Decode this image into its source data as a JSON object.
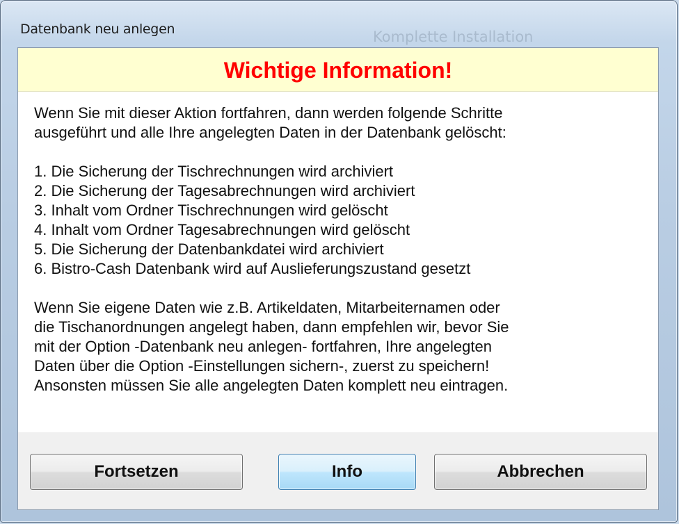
{
  "window": {
    "title": "Datenbank neu anlegen",
    "background_ghost_label": "Komplette Installation"
  },
  "banner": {
    "heading": "Wichtige Information!"
  },
  "body": {
    "intro_line1": "Wenn Sie mit dieser Aktion fortfahren, dann werden folgende Schritte",
    "intro_line2": "ausgeführt und alle Ihre angelegten Daten in der Datenbank gelöscht:",
    "steps": [
      "1. Die Sicherung der Tischrechnungen wird archiviert",
      "2. Die Sicherung der Tagesabrechnungen wird archiviert",
      "3. Inhalt vom Ordner Tischrechnungen wird gelöscht",
      "4. Inhalt vom Ordner Tagesabrechnungen wird gelöscht",
      "5. Die Sicherung der Datenbankdatei wird archiviert",
      "6. Bistro-Cash Datenbank wird auf Auslieferungszustand gesetzt"
    ],
    "note_lines": [
      "Wenn Sie eigene Daten wie z.B. Artikeldaten, Mitarbeiternamen oder",
      "die Tischanordnungen angelegt haben, dann empfehlen wir, bevor Sie",
      "mit der Option -Datenbank neu anlegen- fortfahren, Ihre angelegten",
      "Daten über die Option -Einstellungen sichern-, zuerst zu speichern!",
      "Ansonsten müssen Sie alle angelegten Daten komplett neu eintragen."
    ]
  },
  "buttons": {
    "continue_label": "Fortsetzen",
    "info_label": "Info",
    "cancel_label": "Abbrechen"
  },
  "colors": {
    "banner_background": "#ffffd1",
    "heading_color": "#ff0000",
    "default_button_border": "#3c7fb1"
  }
}
